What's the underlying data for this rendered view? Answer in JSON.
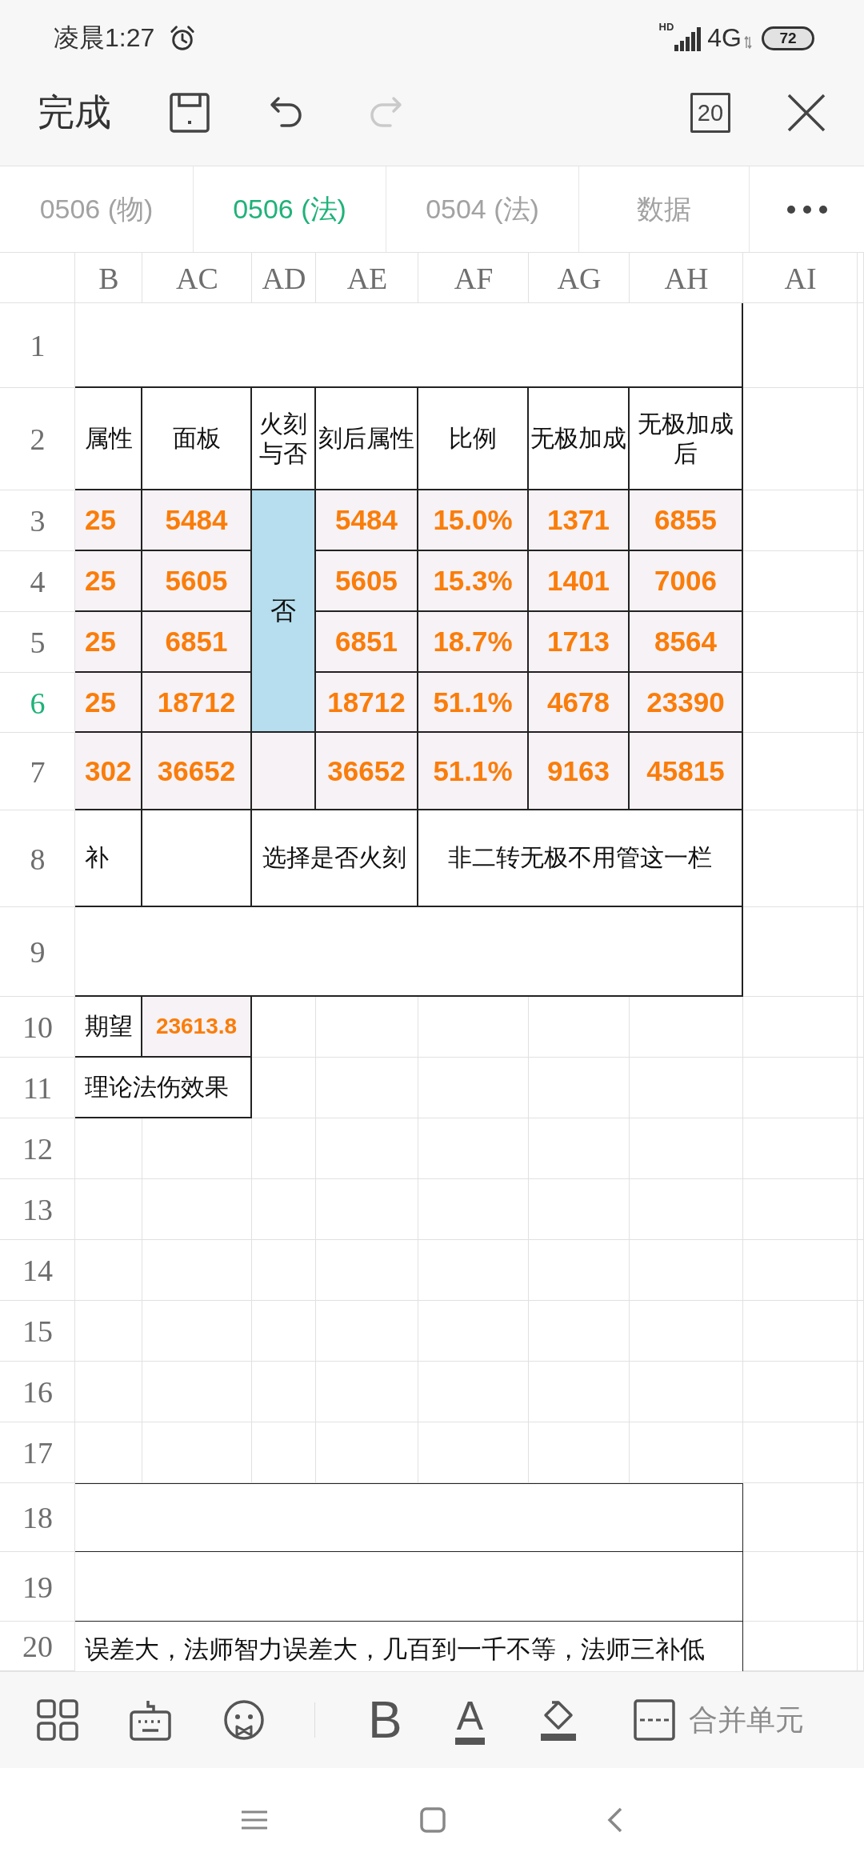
{
  "status_bar": {
    "time": "凌晨1:27",
    "signal_label": "HD",
    "network": "4G",
    "battery": "72"
  },
  "toolbar": {
    "done": "完成",
    "undo_disabled": false,
    "redo_disabled": true,
    "count": "20"
  },
  "sheet_tabs": [
    {
      "label": "0506 (物)",
      "selected": false
    },
    {
      "label": "0506 (法)",
      "selected": true
    },
    {
      "label": "0504 (法)",
      "selected": false
    },
    {
      "label": "数据",
      "selected": false
    }
  ],
  "columns": [
    "B",
    "AC",
    "AD",
    "AE",
    "AF",
    "AG",
    "AH",
    "AI"
  ],
  "rows": [
    {
      "number": "1",
      "selected": false
    },
    {
      "number": "2",
      "selected": false,
      "cells": [
        {
          "kind": "header",
          "text": "属性"
        },
        {
          "kind": "header",
          "text": "面板"
        },
        {
          "kind": "header",
          "text": "火刻与否"
        },
        {
          "kind": "header",
          "text": "刻后属性"
        },
        {
          "kind": "header",
          "text": "比例"
        },
        {
          "kind": "header",
          "text": "无极加成"
        },
        {
          "kind": "header",
          "text": "无极加成后"
        }
      ]
    },
    {
      "number": "3",
      "selected": false,
      "cells": [
        {
          "kind": "value",
          "text": "25"
        },
        {
          "kind": "value",
          "text": "5484"
        },
        {
          "kind": "choice",
          "text": "否"
        },
        {
          "kind": "value",
          "text": "5484"
        },
        {
          "kind": "value",
          "text": "15.0%"
        },
        {
          "kind": "value",
          "text": "1371"
        },
        {
          "kind": "value",
          "text": "6855"
        }
      ]
    },
    {
      "number": "4",
      "selected": false,
      "cells": [
        {
          "kind": "value",
          "text": "25"
        },
        {
          "kind": "value",
          "text": "5605"
        },
        {
          "kind": "value",
          "text": "5605"
        },
        {
          "kind": "value",
          "text": "15.3%"
        },
        {
          "kind": "value",
          "text": "1401"
        },
        {
          "kind": "value",
          "text": "7006"
        }
      ]
    },
    {
      "number": "5",
      "selected": false,
      "cells": [
        {
          "kind": "value",
          "text": "25"
        },
        {
          "kind": "value",
          "text": "6851"
        },
        {
          "kind": "value",
          "text": "6851"
        },
        {
          "kind": "value",
          "text": "18.7%"
        },
        {
          "kind": "value",
          "text": "1713"
        },
        {
          "kind": "value",
          "text": "8564"
        }
      ]
    },
    {
      "number": "6",
      "selected": true,
      "cells": [
        {
          "kind": "value",
          "text": "25"
        },
        {
          "kind": "value",
          "text": "18712"
        },
        {
          "kind": "value",
          "text": "18712"
        },
        {
          "kind": "value",
          "text": "51.1%"
        },
        {
          "kind": "value",
          "text": "4678"
        },
        {
          "kind": "value",
          "text": "23390"
        }
      ]
    },
    {
      "number": "7",
      "selected": false,
      "cells": [
        {
          "kind": "value",
          "text": "302"
        },
        {
          "kind": "value",
          "text": "36652"
        },
        {
          "kind": "value",
          "text": "36652"
        },
        {
          "kind": "value",
          "text": "51.1%"
        },
        {
          "kind": "value",
          "text": "9163"
        },
        {
          "kind": "value",
          "text": "45815"
        }
      ]
    },
    {
      "number": "8",
      "selected": false,
      "cells": [
        {
          "kind": "label",
          "text": "补"
        },
        {
          "kind": "label",
          "text": "选择是否火刻"
        },
        {
          "kind": "label",
          "text": "非二转无极不用管这一栏"
        }
      ]
    },
    {
      "number": "9",
      "selected": false
    },
    {
      "number": "10",
      "selected": false,
      "cells": [
        {
          "kind": "label",
          "text": "期望"
        },
        {
          "kind": "value",
          "text": "23613.8"
        }
      ]
    },
    {
      "number": "11",
      "selected": false,
      "cells": [
        {
          "kind": "label",
          "text": "理论法伤效果"
        }
      ]
    },
    {
      "number": "12",
      "selected": false
    },
    {
      "number": "13",
      "selected": false
    },
    {
      "number": "14",
      "selected": false
    },
    {
      "number": "15",
      "selected": false
    },
    {
      "number": "16",
      "selected": false
    },
    {
      "number": "17",
      "selected": false
    },
    {
      "number": "18",
      "selected": false
    },
    {
      "number": "19",
      "selected": false
    },
    {
      "number": "20",
      "selected": false,
      "cells": [
        {
          "kind": "note",
          "text": "误差大，法师智力误差大，几百到一千不等，法师三补低"
        }
      ]
    }
  ],
  "format_bar": {
    "bold": "B",
    "font_color": "A",
    "merge": "合并单元"
  }
}
